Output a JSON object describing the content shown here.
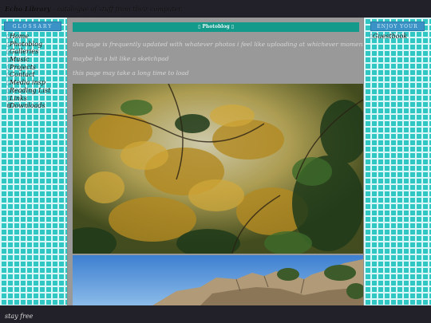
{
  "topbar": {
    "site_name": "Echo Library",
    "tagline": " - catalogue of stuff from their computer."
  },
  "left_sidebar": {
    "header": "GLOSSARY",
    "items": [
      {
        "label": "Home",
        "icon": "page-icon"
      },
      {
        "label": "Photoblog",
        "icon": "page-icon"
      },
      {
        "label": "Galleries",
        "icon": "page-icon"
      },
      {
        "label": "Music",
        "icon": "page-icon"
      },
      {
        "label": "Projects",
        "icon": "page-icon"
      },
      {
        "label": "Contact",
        "icon": "page-icon"
      },
      {
        "label": "Media insp",
        "icon": "page-icon"
      },
      {
        "label": "Reading List",
        "icon": "page-icon"
      },
      {
        "label": "Links",
        "icon": "page-icon"
      },
      {
        "label": "Downloads",
        "icon": "gear-icon"
      }
    ]
  },
  "main": {
    "title": "Photoblog",
    "notes": [
      "this page is frequently updated with whatever photos i feel like uploading at whichever moment",
      "maybe its a bit like a sketchpad",
      "this page may take a long time to load"
    ]
  },
  "right_sidebar": {
    "header": "ENJOY YOUR STAY",
    "items": [
      {
        "label": "Guestbook",
        "icon": "page-icon"
      }
    ]
  },
  "footer": {
    "text": "stay free"
  },
  "colors": {
    "tile_base": "#2fc6c4",
    "tile_grid": "#d8f6f5",
    "main_bg": "#999999",
    "main_header": "#139a8b",
    "side_header": "#3a92c6"
  }
}
